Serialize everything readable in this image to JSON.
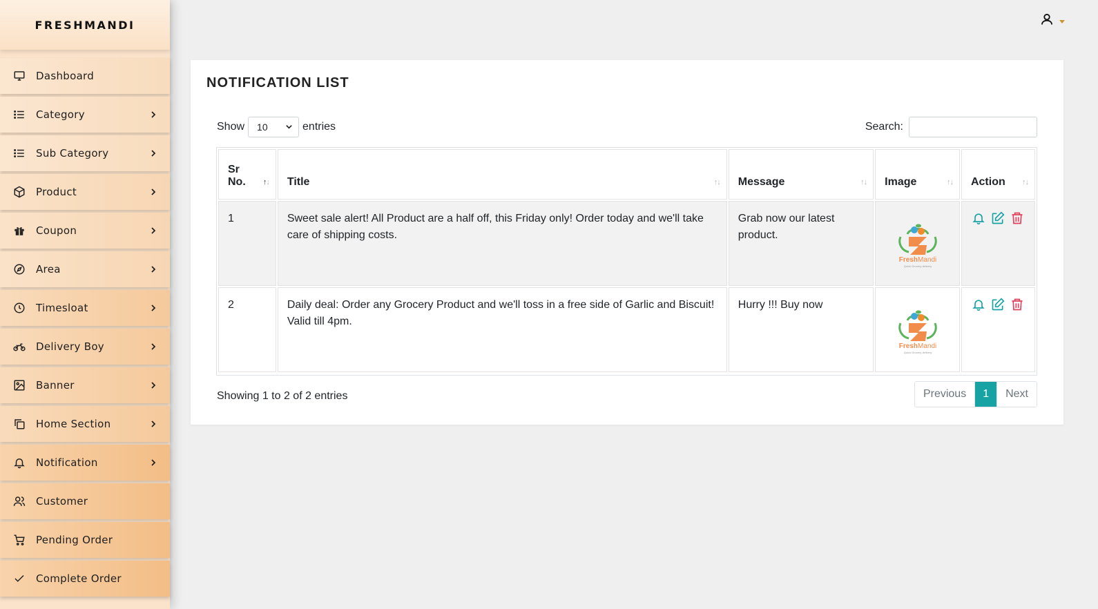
{
  "brand": "FRESHMANDI",
  "sidebar": {
    "items": [
      {
        "label": "Dashboard",
        "icon": "monitor-icon",
        "has_submenu": false
      },
      {
        "label": "Category",
        "icon": "list-icon",
        "has_submenu": true
      },
      {
        "label": "Sub Category",
        "icon": "list-icon",
        "has_submenu": true
      },
      {
        "label": "Product",
        "icon": "box-icon",
        "has_submenu": true
      },
      {
        "label": "Coupon",
        "icon": "gift-icon",
        "has_submenu": true
      },
      {
        "label": "Area",
        "icon": "compass-icon",
        "has_submenu": true
      },
      {
        "label": "Timesloat",
        "icon": "clock-icon",
        "has_submenu": true
      },
      {
        "label": "Delivery Boy",
        "icon": "motorcycle-icon",
        "has_submenu": true
      },
      {
        "label": "Banner",
        "icon": "image-icon",
        "has_submenu": true
      },
      {
        "label": "Home Section",
        "icon": "copy-icon",
        "has_submenu": true
      },
      {
        "label": "Notification",
        "icon": "bell-icon",
        "has_submenu": true
      },
      {
        "label": "Customer",
        "icon": "users-icon",
        "has_submenu": false
      },
      {
        "label": "Pending Order",
        "icon": "cart-icon",
        "has_submenu": false
      },
      {
        "label": "Complete Order",
        "icon": "check-icon",
        "has_submenu": false
      }
    ]
  },
  "page": {
    "title": "NOTIFICATION LIST"
  },
  "controls": {
    "show_label": "Show",
    "entries_value": "10",
    "entries_label": "entries",
    "search_label": "Search:",
    "search_value": ""
  },
  "table": {
    "headers": {
      "sr_line1": "Sr",
      "sr_line2": "No.",
      "title": "Title",
      "message": "Message",
      "image": "Image",
      "action": "Action"
    },
    "rows": [
      {
        "sr": "1",
        "title": "Sweet sale alert! All Product are a half off, this Friday only! Order today and we'll take care of shipping costs.",
        "message": "Grab now our latest product."
      },
      {
        "sr": "2",
        "title": "Daily deal: Order any Grocery Product and we'll toss in a free side of Garlic and Biscuit! Valid till 4pm.",
        "message": "Hurry !!! Buy now"
      }
    ],
    "logo_text_a": "Fresh",
    "logo_text_b": "Mandi",
    "logo_tagline": "Quick Grocery delivery"
  },
  "footer": {
    "info": "Showing 1 to 2 of 2 entries",
    "prev": "Previous",
    "current": "1",
    "next": "Next"
  },
  "colors": {
    "accent": "#17a2a3",
    "delete": "#e0405a",
    "sidebar_bg": "#f7d3ad"
  }
}
